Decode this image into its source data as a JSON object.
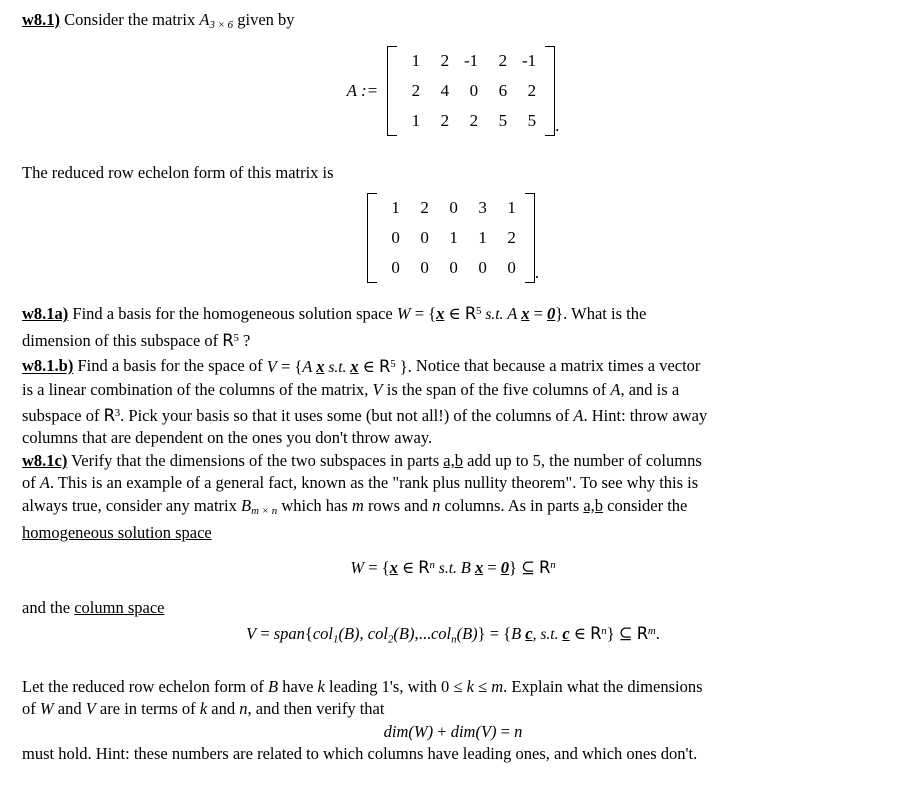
{
  "document": {
    "title": "Linear Algebra Homework w8.1",
    "background_color": "#ffffff",
    "text_color": "#000000"
  },
  "intro": {
    "label": "w8.1)",
    "text_before": " Consider the matrix ",
    "matrix_symbol": "A",
    "matrix_subscript": "3 × 6",
    "text_after": " given by"
  },
  "matrix_A": {
    "label": "A :=",
    "rows": [
      [
        "1",
        "2",
        "-1",
        "2",
        "-1"
      ],
      [
        "2",
        "4",
        "0",
        "6",
        "2"
      ],
      [
        "1",
        "2",
        "2",
        "5",
        "5"
      ]
    ],
    "trailing_punctuation": "."
  },
  "rref_intro": {
    "text": "The reduced row echelon form of this matrix is"
  },
  "matrix_rref": {
    "rows": [
      [
        "1",
        "2",
        "0",
        "3",
        "1"
      ],
      [
        "0",
        "0",
        "1",
        "1",
        "2"
      ],
      [
        "0",
        "0",
        "0",
        "0",
        "0"
      ]
    ],
    "trailing_punctuation": "."
  },
  "part_a": {
    "label": "w8.1a)",
    "line1_pre": " Find a basis for the homogeneous solution space ",
    "eq_W": "W",
    "eq_eq": " = {",
    "eq_x": "x",
    "eq_in": " ∈ ",
    "eq_R": "R",
    "eq_exp": "5",
    "eq_st": " s.t. ",
    "eq_A": "A ",
    "eq_x2": "x",
    "eq_eq2": " = ",
    "eq_zero": "0",
    "eq_close": "}.",
    "line1_post": "  What is the",
    "line2_pre": "dimension of this subspace of ",
    "line2_R": "R",
    "line2_exp": "5",
    "line2_post": " ?"
  },
  "part_b": {
    "label": "w8.1.b)",
    "seg1": " Find a basis for the space of ",
    "eq_V": "V",
    "eq_eq": " = {",
    "eq_A": "A ",
    "eq_x": "x",
    "eq_st": " s.t. ",
    "eq_x2": "x",
    "eq_in": " ∈ ",
    "eq_R": "R",
    "eq_exp": "5",
    "eq_close": " }.",
    "seg2": "  Notice that because a matrix times a vector",
    "line2_a": "is a linear combination of the columns of the matrix, ",
    "line2_V": "V",
    "line2_b": " is the span of the five columns of ",
    "line2_A": "A",
    "line2_c": ", and is a",
    "line3_a": "subspace of  ",
    "line3_R": "R",
    "line3_exp": "3",
    "line3_b": ". Pick your basis so that it uses some (but not all!) of the columns of ",
    "line3_A": "A",
    "line3_c": ".  Hint: throw away",
    "line4": "columns that are dependent on the ones you don't throw away."
  },
  "part_c": {
    "label": "w8.1c)",
    "line1_a": " Verify that the dimensions of the two subspaces in parts ",
    "line1_ab": "a,b",
    "line1_b": " add up to 5, the number of columns",
    "line2_a": "of ",
    "line2_A": "A",
    "line2_b": ".  This is an example of a general fact, known as the \"rank plus nullity theorem\".  To see why this is",
    "line3_a": "always true, consider any matrix ",
    "line3_B": "B",
    "line3_Bsub": "m × n",
    "line3_b": " which has ",
    "line3_m": "m",
    "line3_c": " rows and ",
    "line3_n": "n",
    "line3_d": " columns. As in parts ",
    "line3_ab": "a,b",
    "line3_e": " consider the",
    "line4_underlined": "homogeneous solution space"
  },
  "equation_W": {
    "W": "W",
    "eq": " = {",
    "x": "x",
    "in": " ∈ ",
    "R": "R",
    "exp": "n",
    "st": " s.t. ",
    "B": "B ",
    "x2": "x",
    "eq2": " = ",
    "zero": "0",
    "close": "} ",
    "subset": "⊆ ",
    "R2": "R",
    "exp2": "n"
  },
  "column_space_intro": {
    "pre": "and the ",
    "underlined": "column space"
  },
  "equation_V": {
    "V": "V",
    "eq": " = ",
    "span": "span",
    "brace_open": "{",
    "col1": "col",
    "sub1": "1",
    "argB1": "(B)",
    "comma1": ", ",
    "col2": "col",
    "sub2": "2",
    "argB2": "(B)",
    "ellipsis": ",...",
    "coln": "col",
    "subn": "n",
    "argBn": "(B)",
    "brace_close": "}",
    "eq2": " = {",
    "Bc": "B ",
    "c": "c",
    "st": ", s.t. ",
    "c2": "c",
    "in": " ∈ ",
    "R": "R",
    "exp": "n",
    "close": "} ",
    "subset": "⊆ ",
    "R2": "R",
    "exp2": "m",
    "period": "."
  },
  "closing": {
    "line1_a": "Let the reduced row echelon form of ",
    "line1_B": "B",
    "line1_b": " have ",
    "line1_k": "k",
    "line1_c": " leading 1's, with 0 ",
    "line1_le1": "≤",
    "line1_k2": " k ",
    "line1_le2": "≤",
    "line1_m": " m",
    "line1_d": ".  Explain what the dimensions",
    "line2_a": "of ",
    "line2_W": "W",
    "line2_b": " and ",
    "line2_V": "V",
    "line2_c": " are in terms of ",
    "line2_k": "k",
    "line2_d": " and ",
    "line2_n": "n",
    "line2_e": ", and then verify that"
  },
  "equation_dim": {
    "dim1": "dim",
    "open1": "(",
    "W": "W",
    "close1": ")",
    "plus": " + ",
    "dim2": "dim",
    "open2": "(",
    "V": "V",
    "close2": ")",
    "eq": " = ",
    "n": "n"
  },
  "final_line": {
    "text": "must hold.  Hint: these numbers are related to which columns have leading ones, and which ones don't."
  }
}
